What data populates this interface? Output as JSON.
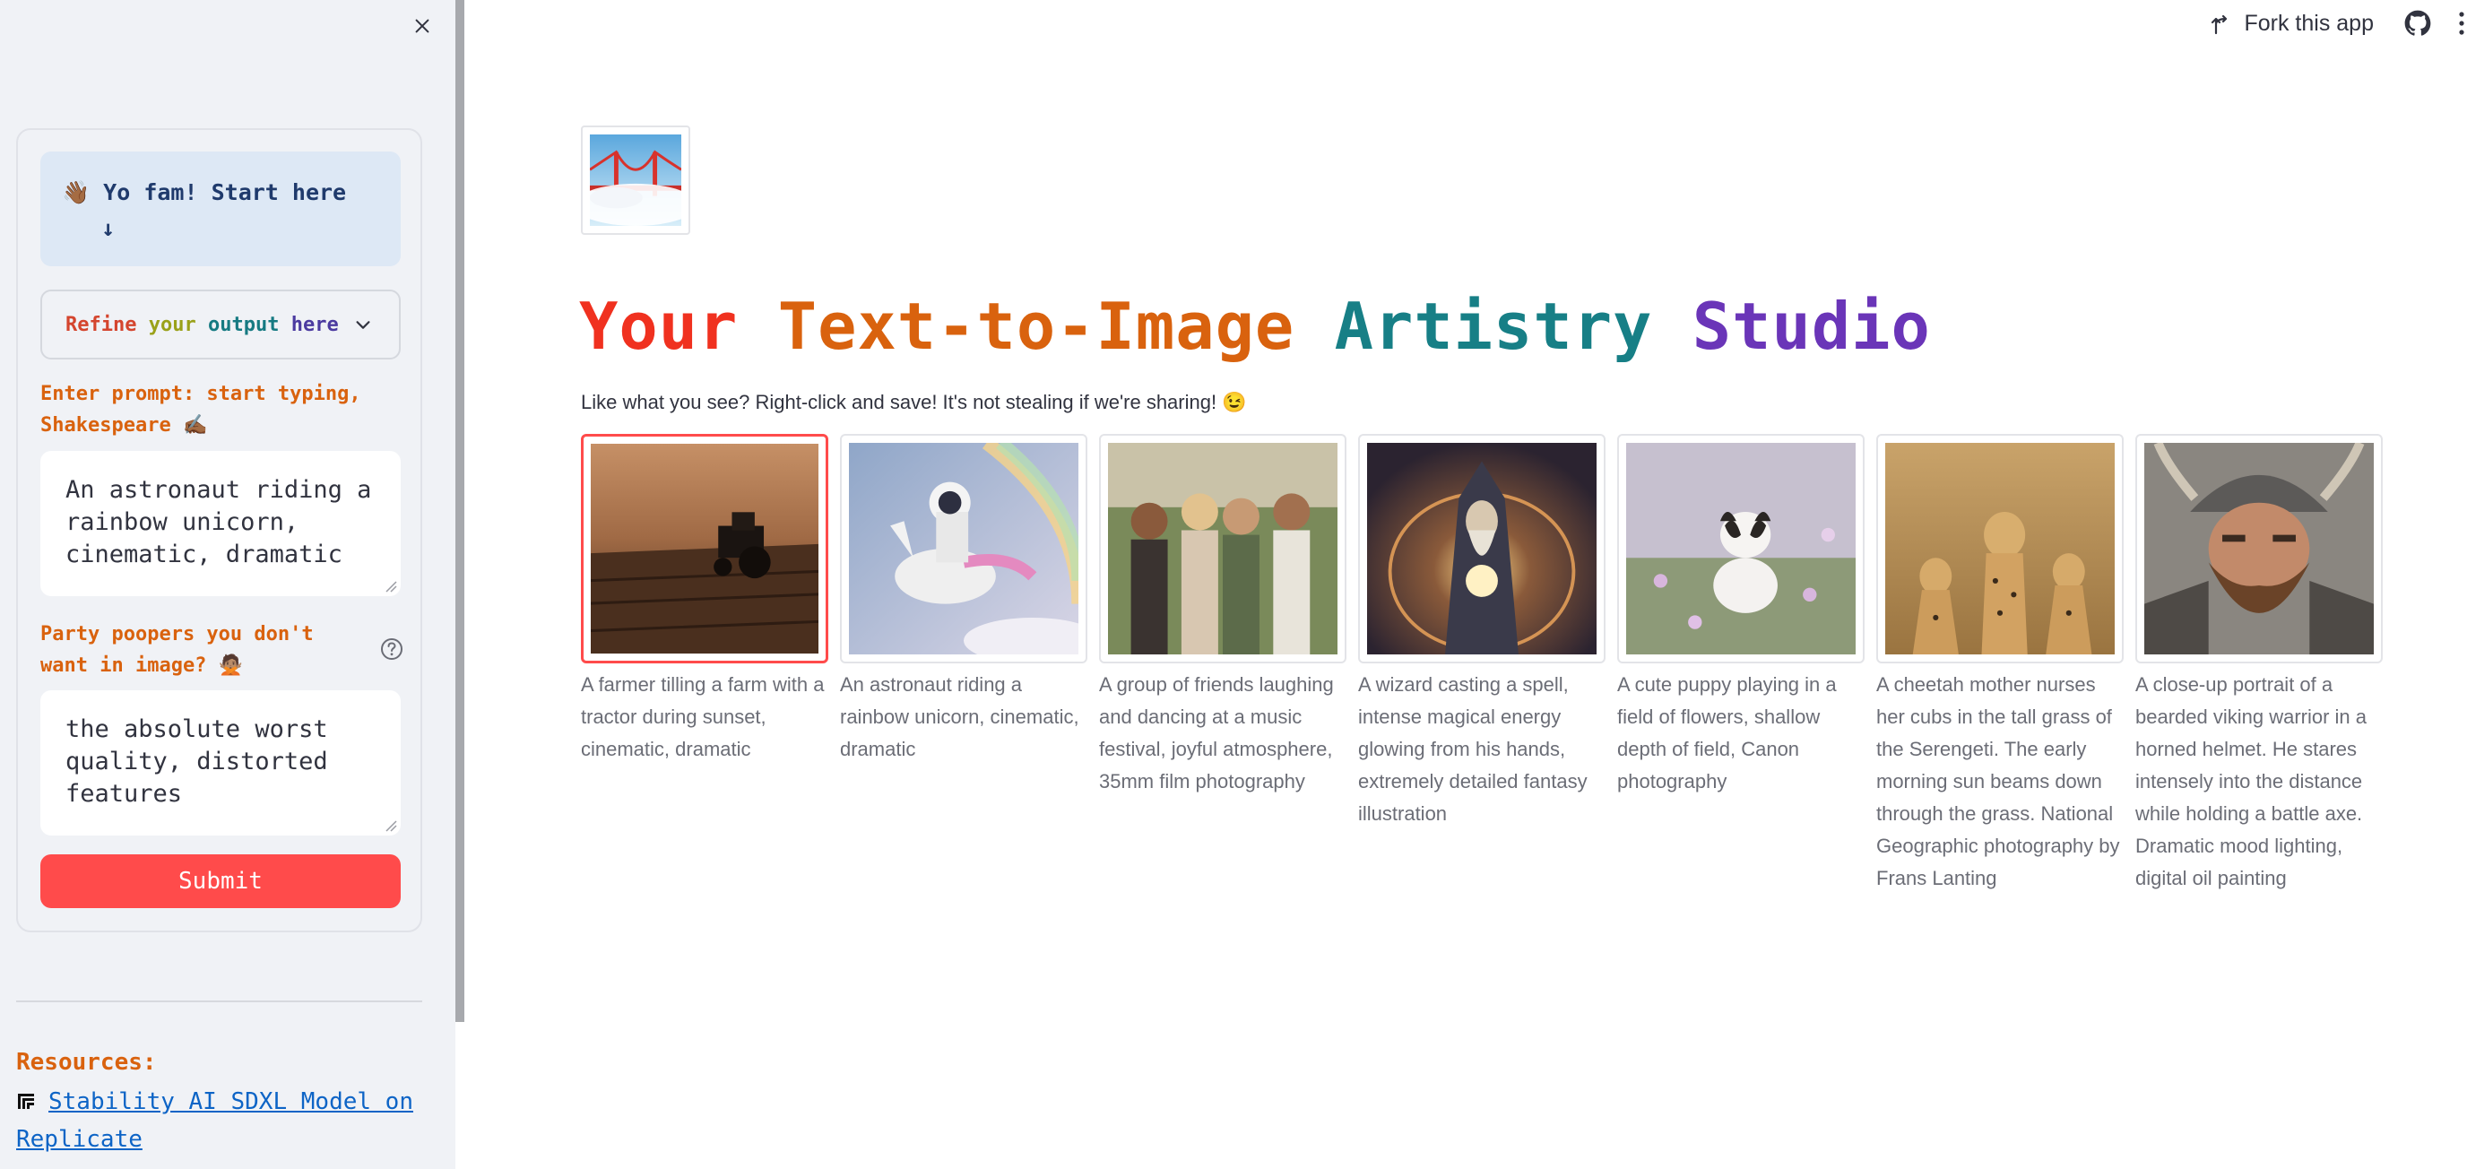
{
  "sidebar": {
    "info_text": "👋🏾 Yo fam! Start here",
    "info_arrow": "↓",
    "expander": {
      "w1": "Refine",
      "w2": "your",
      "w3": "output",
      "w4": "here"
    },
    "prompt_label": "Enter prompt: start typing, Shakespeare ✍🏾",
    "prompt_value": "An astronaut riding a rainbow unicorn, cinematic, dramatic",
    "negative_label": "Party poopers you don't want in image? 🙅🏽",
    "negative_value": "the absolute worst quality, distorted features",
    "submit_label": "Submit",
    "resources_title": "Resources:",
    "resource_link": "Stability AI SDXL Model on Replicate"
  },
  "toolbar": {
    "fork_label": "Fork this app"
  },
  "main": {
    "title_parts": [
      {
        "text": "Your",
        "color": "#f0311f"
      },
      {
        "text": "Text-to-Image",
        "color": "#d9620e"
      },
      {
        "text": "Artistry",
        "color": "#177f86"
      },
      {
        "text": "Studio",
        "color": "#6a35b8"
      }
    ],
    "subtitle": "Like what you see? Right-click and save! It's not stealing if we're sharing! 😉",
    "gallery": [
      {
        "caption": "A farmer tilling a farm with a tractor during sunset, cinematic, dramatic",
        "selected": true
      },
      {
        "caption": "An astronaut riding a rainbow unicorn, cinematic, dramatic",
        "selected": false
      },
      {
        "caption": "A group of friends laughing and dancing at a music festival, joyful atmosphere, 35mm film photography",
        "selected": false
      },
      {
        "caption": "A wizard casting a spell, intense magical energy glowing from his hands, extremely detailed fantasy illustration",
        "selected": false
      },
      {
        "caption": "A cute puppy playing in a field of flowers, shallow depth of field, Canon photography",
        "selected": false
      },
      {
        "caption": "A cheetah mother nurses her cubs in the tall grass of the Serengeti. The early morning sun beams down through the grass. National Geographic photography by Frans Lanting",
        "selected": false
      },
      {
        "caption": "A close-up portrait of a bearded viking warrior in a horned helmet. He stares intensely into the distance while holding a battle axe. Dramatic mood lighting, digital oil painting",
        "selected": false
      }
    ]
  },
  "colors": {
    "accent": "#ff4b4b",
    "sidebar_bg": "#f0f2f6",
    "label_orange": "#d9620e",
    "link_blue": "#0d64c6"
  }
}
